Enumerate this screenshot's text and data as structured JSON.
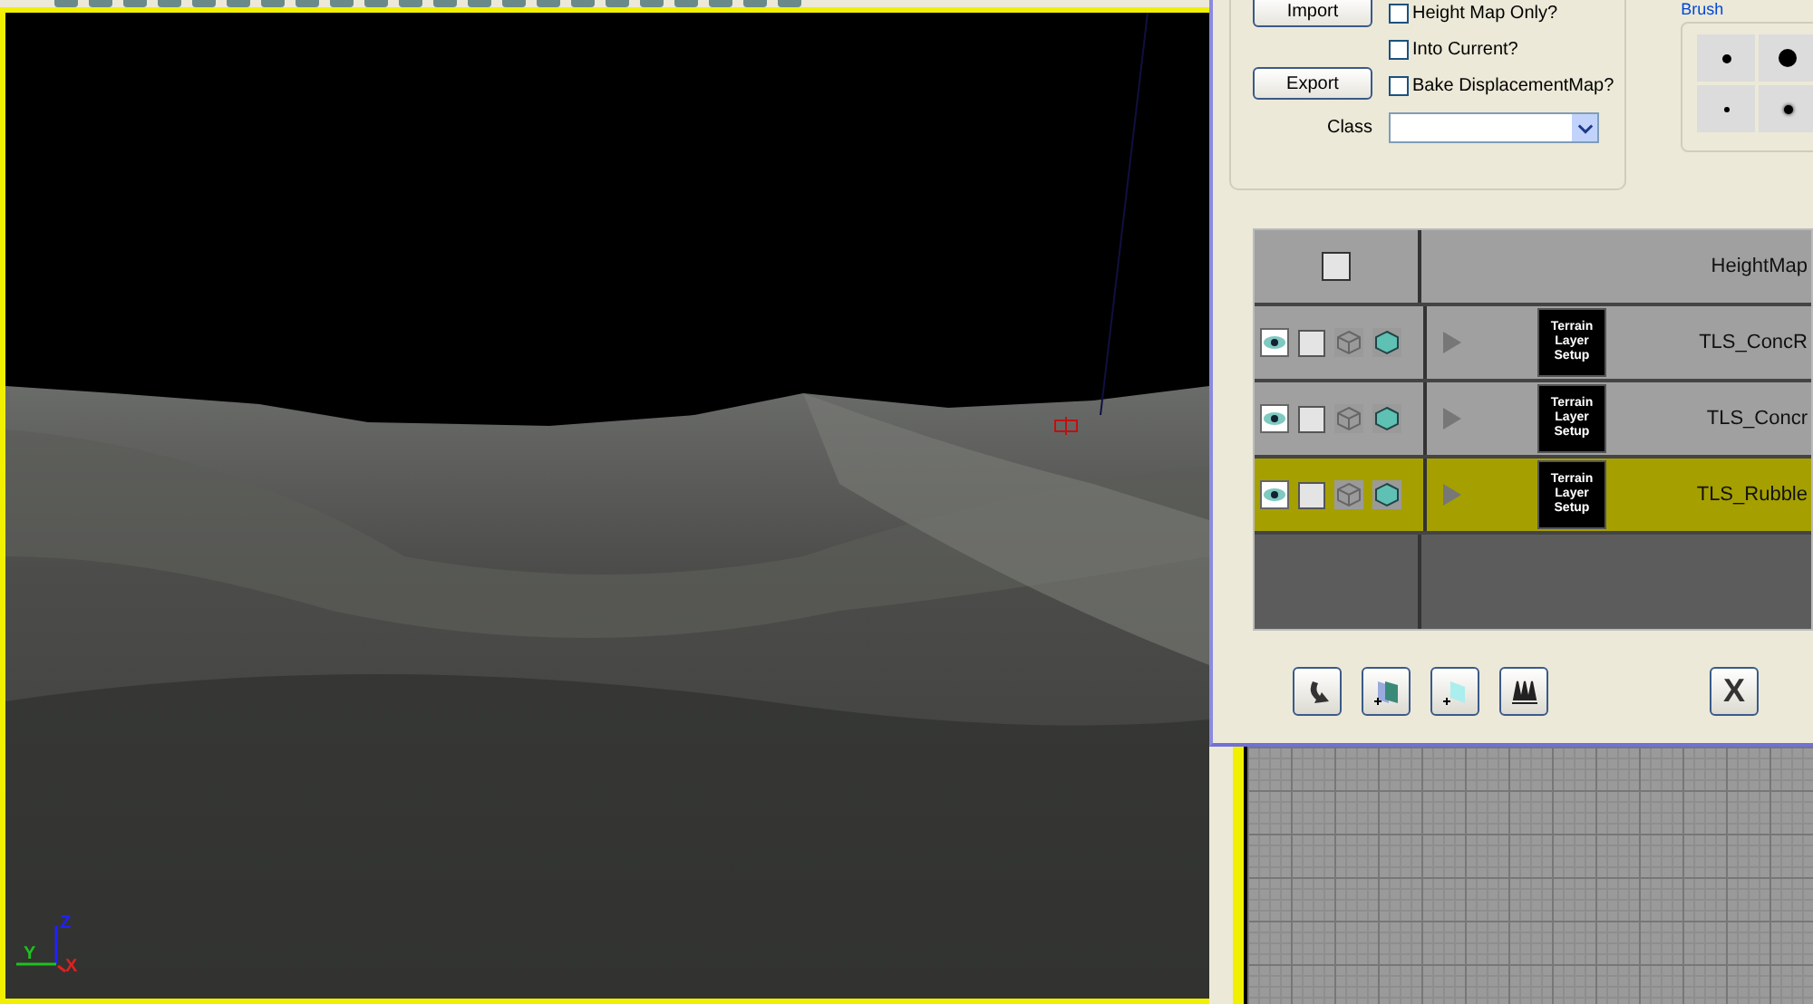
{
  "viewport": {
    "axis": {
      "z": "Z",
      "y": "Y",
      "x": "X"
    }
  },
  "dialog": {
    "import_button": "Import",
    "export_button": "Export",
    "options": [
      {
        "label": "Height Map Only?",
        "checked": false
      },
      {
        "label": "Into Current?",
        "checked": false
      },
      {
        "label": "Bake DisplacementMap?",
        "checked": false
      }
    ],
    "class_label": "Class",
    "brush_label": "Brush",
    "layers_header": {
      "label": "HeightMap",
      "checked": false
    },
    "layers": [
      {
        "name": "TLS_ConcR",
        "thumbnail": [
          "Terrain",
          "Layer",
          "Setup"
        ],
        "visible": true,
        "checked": false,
        "selected": false
      },
      {
        "name": "TLS_Concr",
        "thumbnail": [
          "Terrain",
          "Layer",
          "Setup"
        ],
        "visible": true,
        "checked": false,
        "selected": false
      },
      {
        "name": "TLS_Rubble",
        "thumbnail": [
          "Terrain",
          "Layer",
          "Setup"
        ],
        "visible": true,
        "checked": false,
        "selected": true
      }
    ],
    "close_button": "X"
  }
}
